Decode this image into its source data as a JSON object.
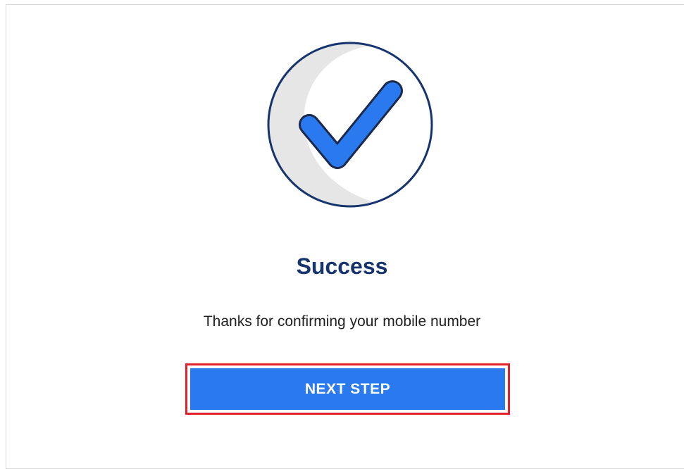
{
  "illustration": {
    "icon": "checkmark-in-circle",
    "colors": {
      "circle_outline": "#16346e",
      "circle_shadow": "#e6e6e6",
      "check_fill": "#2a79ef"
    }
  },
  "dialog": {
    "title": "Success",
    "message": "Thanks for confirming your mobile number",
    "next_button_label": "NEXT STEP"
  },
  "colors": {
    "title": "#16346e",
    "button_background": "#2a79ef",
    "button_highlight_border": "#e3202b"
  }
}
